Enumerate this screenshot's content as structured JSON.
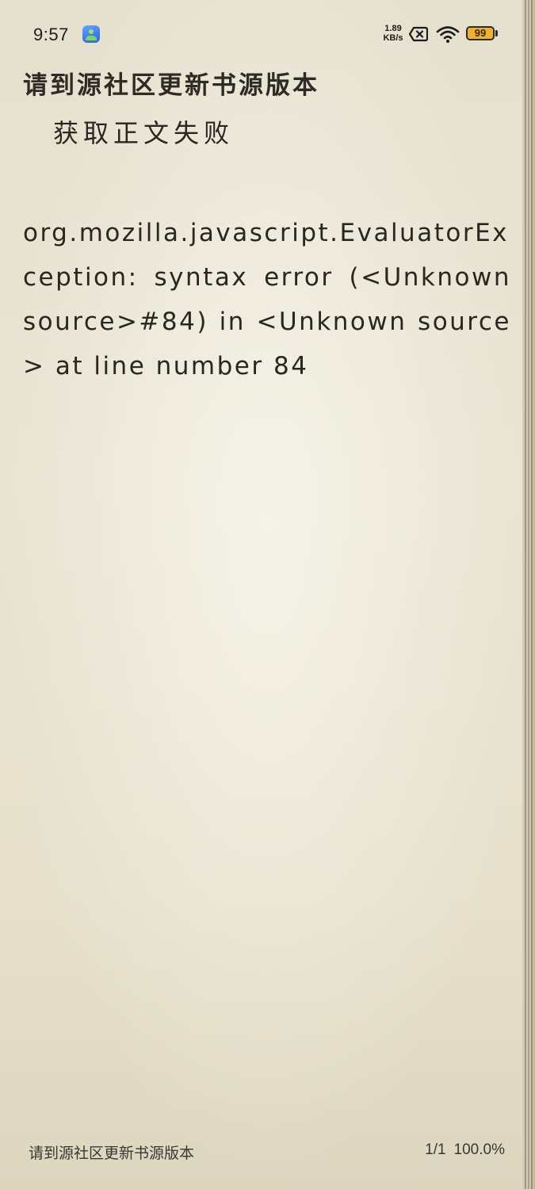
{
  "status_bar": {
    "time": "9:57",
    "app_icon": "gallery-app-icon",
    "net_speed_value": "1.89",
    "net_speed_unit": "KB/s",
    "battery_level": "99",
    "battery_color": "#efb130",
    "icons": [
      "close-box-icon",
      "wifi-icon",
      "battery-icon"
    ]
  },
  "reader": {
    "chapter_title": "请到源社区更新书源版本",
    "paragraphs": [
      "获取正文失败",
      "org.mozilla.javascript.EvaluatorException: syntax error (<Unknown source>#84) in <Unknown source> at line number 84"
    ]
  },
  "footer": {
    "chapter_title": "请到源社区更新书源版本",
    "page_indicator": "1/1",
    "progress": "100.0%"
  }
}
